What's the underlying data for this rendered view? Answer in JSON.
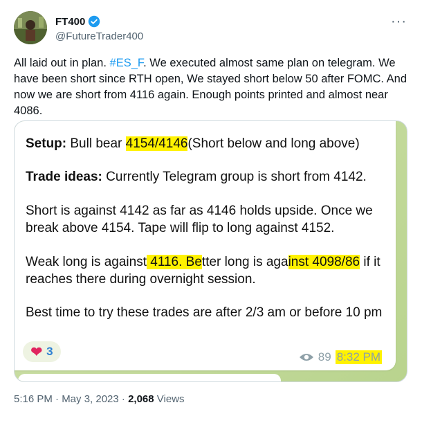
{
  "author": {
    "display_name": "FT400",
    "handle": "@FutureTrader400"
  },
  "more_icon": "more-icon",
  "tweet": {
    "text_part1": "All laid out in plan. ",
    "hashtag": "#ES_F",
    "text_part2": ". We executed almost same plan on telegram. We have been short since RTH open, We stayed short below 50 after FOMC. And now we are short from 4116 again. Enough points printed and almost near 4086."
  },
  "telegram_message": {
    "setup_label": "Setup:",
    "setup_pre": " Bull bear ",
    "setup_hl": "4154/4146",
    "setup_post": "(Short below and long above)",
    "ideas_label": "Trade ideas:",
    "ideas_text": " Currently Telegram group is short from 4142.",
    "para3": "Short is against 4142 as far as 4146 holds upside. Once we break above 4154. Tape will flip to long against 4152.",
    "para4_pre": "Weak long is against",
    "para4_hl1": " 4116. Be",
    "para4_mid": "tter long is aga",
    "para4_hl2": "inst 4098/86",
    "para4_post": " if it reaches there during overnight session.",
    "para5": "Best time to try these trades are after 2/3 am or before 10 pm",
    "reaction_count": "3",
    "views": "89",
    "time": "8:32 PM"
  },
  "footer": {
    "timestamp": "5:16 PM · May 3, 2023 · ",
    "views_count": "2,068",
    "views_label": " Views"
  },
  "colors": {
    "accent": "#1d9bf0",
    "highlight": "#fff200",
    "telegram_bg": "#c7dca0"
  }
}
